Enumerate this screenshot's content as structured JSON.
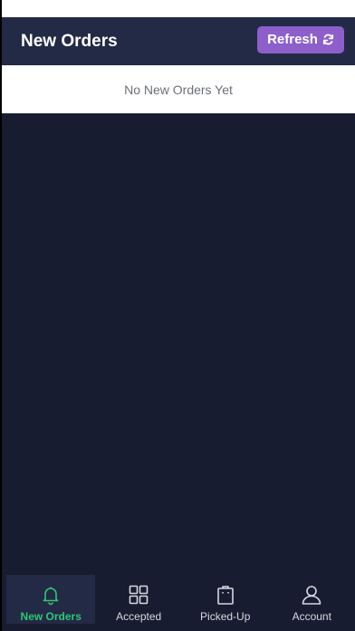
{
  "header": {
    "title": "New Orders",
    "refresh_label": "Refresh",
    "refresh_icon": "refresh-icon"
  },
  "orders": {
    "empty_message": "No New Orders Yet"
  },
  "tabs": [
    {
      "label": "New Orders",
      "icon": "bell-icon",
      "active": true
    },
    {
      "label": "Accepted",
      "icon": "grid-icon",
      "active": false
    },
    {
      "label": "Picked-Up",
      "icon": "shopping-bag-icon",
      "active": false
    },
    {
      "label": "Account",
      "icon": "user-icon",
      "active": false
    }
  ],
  "colors": {
    "background": "#181c30",
    "header": "#232a45",
    "accent_button": "#8c5fcb",
    "active_tab": "#2ec774"
  }
}
